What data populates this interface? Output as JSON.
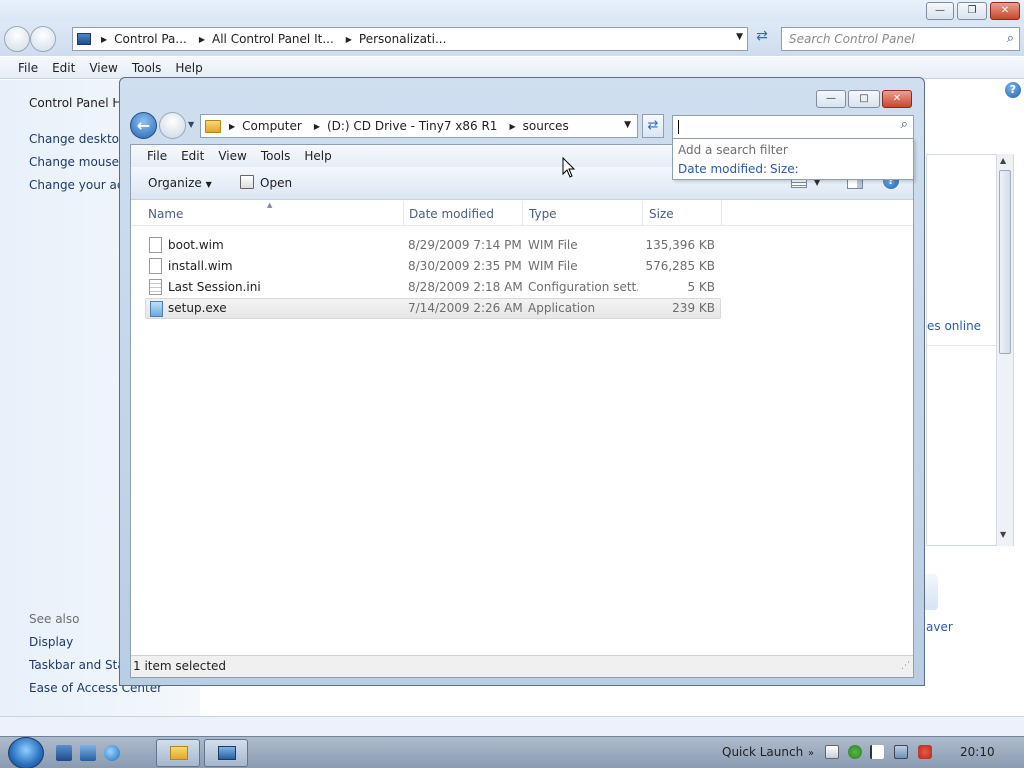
{
  "bg_window": {
    "address": [
      "Control Pa...",
      "All Control Panel It...",
      "Personalizati..."
    ],
    "search_placeholder": "Search Control Panel",
    "menu": [
      "File",
      "Edit",
      "View",
      "Tools",
      "Help"
    ],
    "left_pane": {
      "home": "Control Panel Ho",
      "links": [
        "Change desktop",
        "Change mouse p",
        "Change your acc"
      ],
      "see_also_header": "See also",
      "see_also": [
        "Display",
        "Taskbar and Start",
        "Ease of Access Center"
      ]
    },
    "right_peek": {
      "online_text": "es online",
      "saver_text": "aver"
    }
  },
  "explorer": {
    "address": [
      "Computer",
      "(D:) CD Drive - Tiny7 x86 R1",
      "sources"
    ],
    "search_value": "",
    "search_dropdown": {
      "hint": "Add a search filter",
      "filters": [
        "Date modified:",
        "Size:"
      ]
    },
    "menu": [
      "File",
      "Edit",
      "View",
      "Tools",
      "Help"
    ],
    "commands": {
      "organize": "Organize",
      "open": "Open"
    },
    "columns": [
      "Name",
      "Date modified",
      "Type",
      "Size"
    ],
    "files": [
      {
        "name": "boot.wim",
        "date": "8/29/2009 7:14 PM",
        "type": "WIM File",
        "size": "135,396 KB",
        "icon": "file-icon"
      },
      {
        "name": "install.wim",
        "date": "8/30/2009 2:35 PM",
        "type": "WIM File",
        "size": "576,285 KB",
        "icon": "file-icon"
      },
      {
        "name": "Last Session.ini",
        "date": "8/28/2009 2:18 AM",
        "type": "Configuration sett...",
        "size": "5 KB",
        "icon": "settings-file-icon"
      },
      {
        "name": "setup.exe",
        "date": "7/14/2009 2:26 AM",
        "type": "Application",
        "size": "239 KB",
        "icon": "setup-exe-icon"
      }
    ],
    "selected_row": 3,
    "status": "1 item selected"
  },
  "taskbar": {
    "quick_launch": "Quick Launch",
    "clock": "20:10"
  }
}
